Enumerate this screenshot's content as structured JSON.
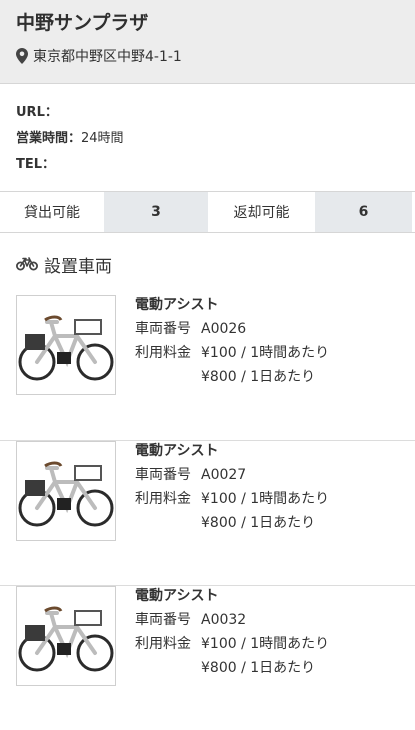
{
  "station": {
    "name": "中野サンプラザ",
    "address": "東京都中野区中野4-1-1"
  },
  "info": {
    "url_label": "URL：",
    "url_value": "",
    "hours_label": "営業時間：",
    "hours_value": "24時間",
    "tel_label": "TEL：",
    "tel_value": ""
  },
  "availability": {
    "rent_label": "貸出可能",
    "rent_count": "3",
    "return_label": "返却可能",
    "return_count": "6"
  },
  "section": {
    "title": "設置車両",
    "icon": "bicycle-icon"
  },
  "vehicles": [
    {
      "type": "電動アシスト",
      "id_label": "車両番号",
      "id": "A0026",
      "fee_label": "利用料金",
      "fee_hour": "¥100 / 1時間あたり",
      "fee_day": "¥800 / 1日あたり"
    },
    {
      "type": "電動アシスト",
      "id_label": "車両番号",
      "id": "A0027",
      "fee_label": "利用料金",
      "fee_hour": "¥100 / 1時間あたり",
      "fee_day": "¥800 / 1日あたり"
    },
    {
      "type": "電動アシスト",
      "id_label": "車両番号",
      "id": "A0032",
      "fee_label": "利用料金",
      "fee_hour": "¥100 / 1時間あたり",
      "fee_day": "¥800 / 1日あたり"
    }
  ]
}
